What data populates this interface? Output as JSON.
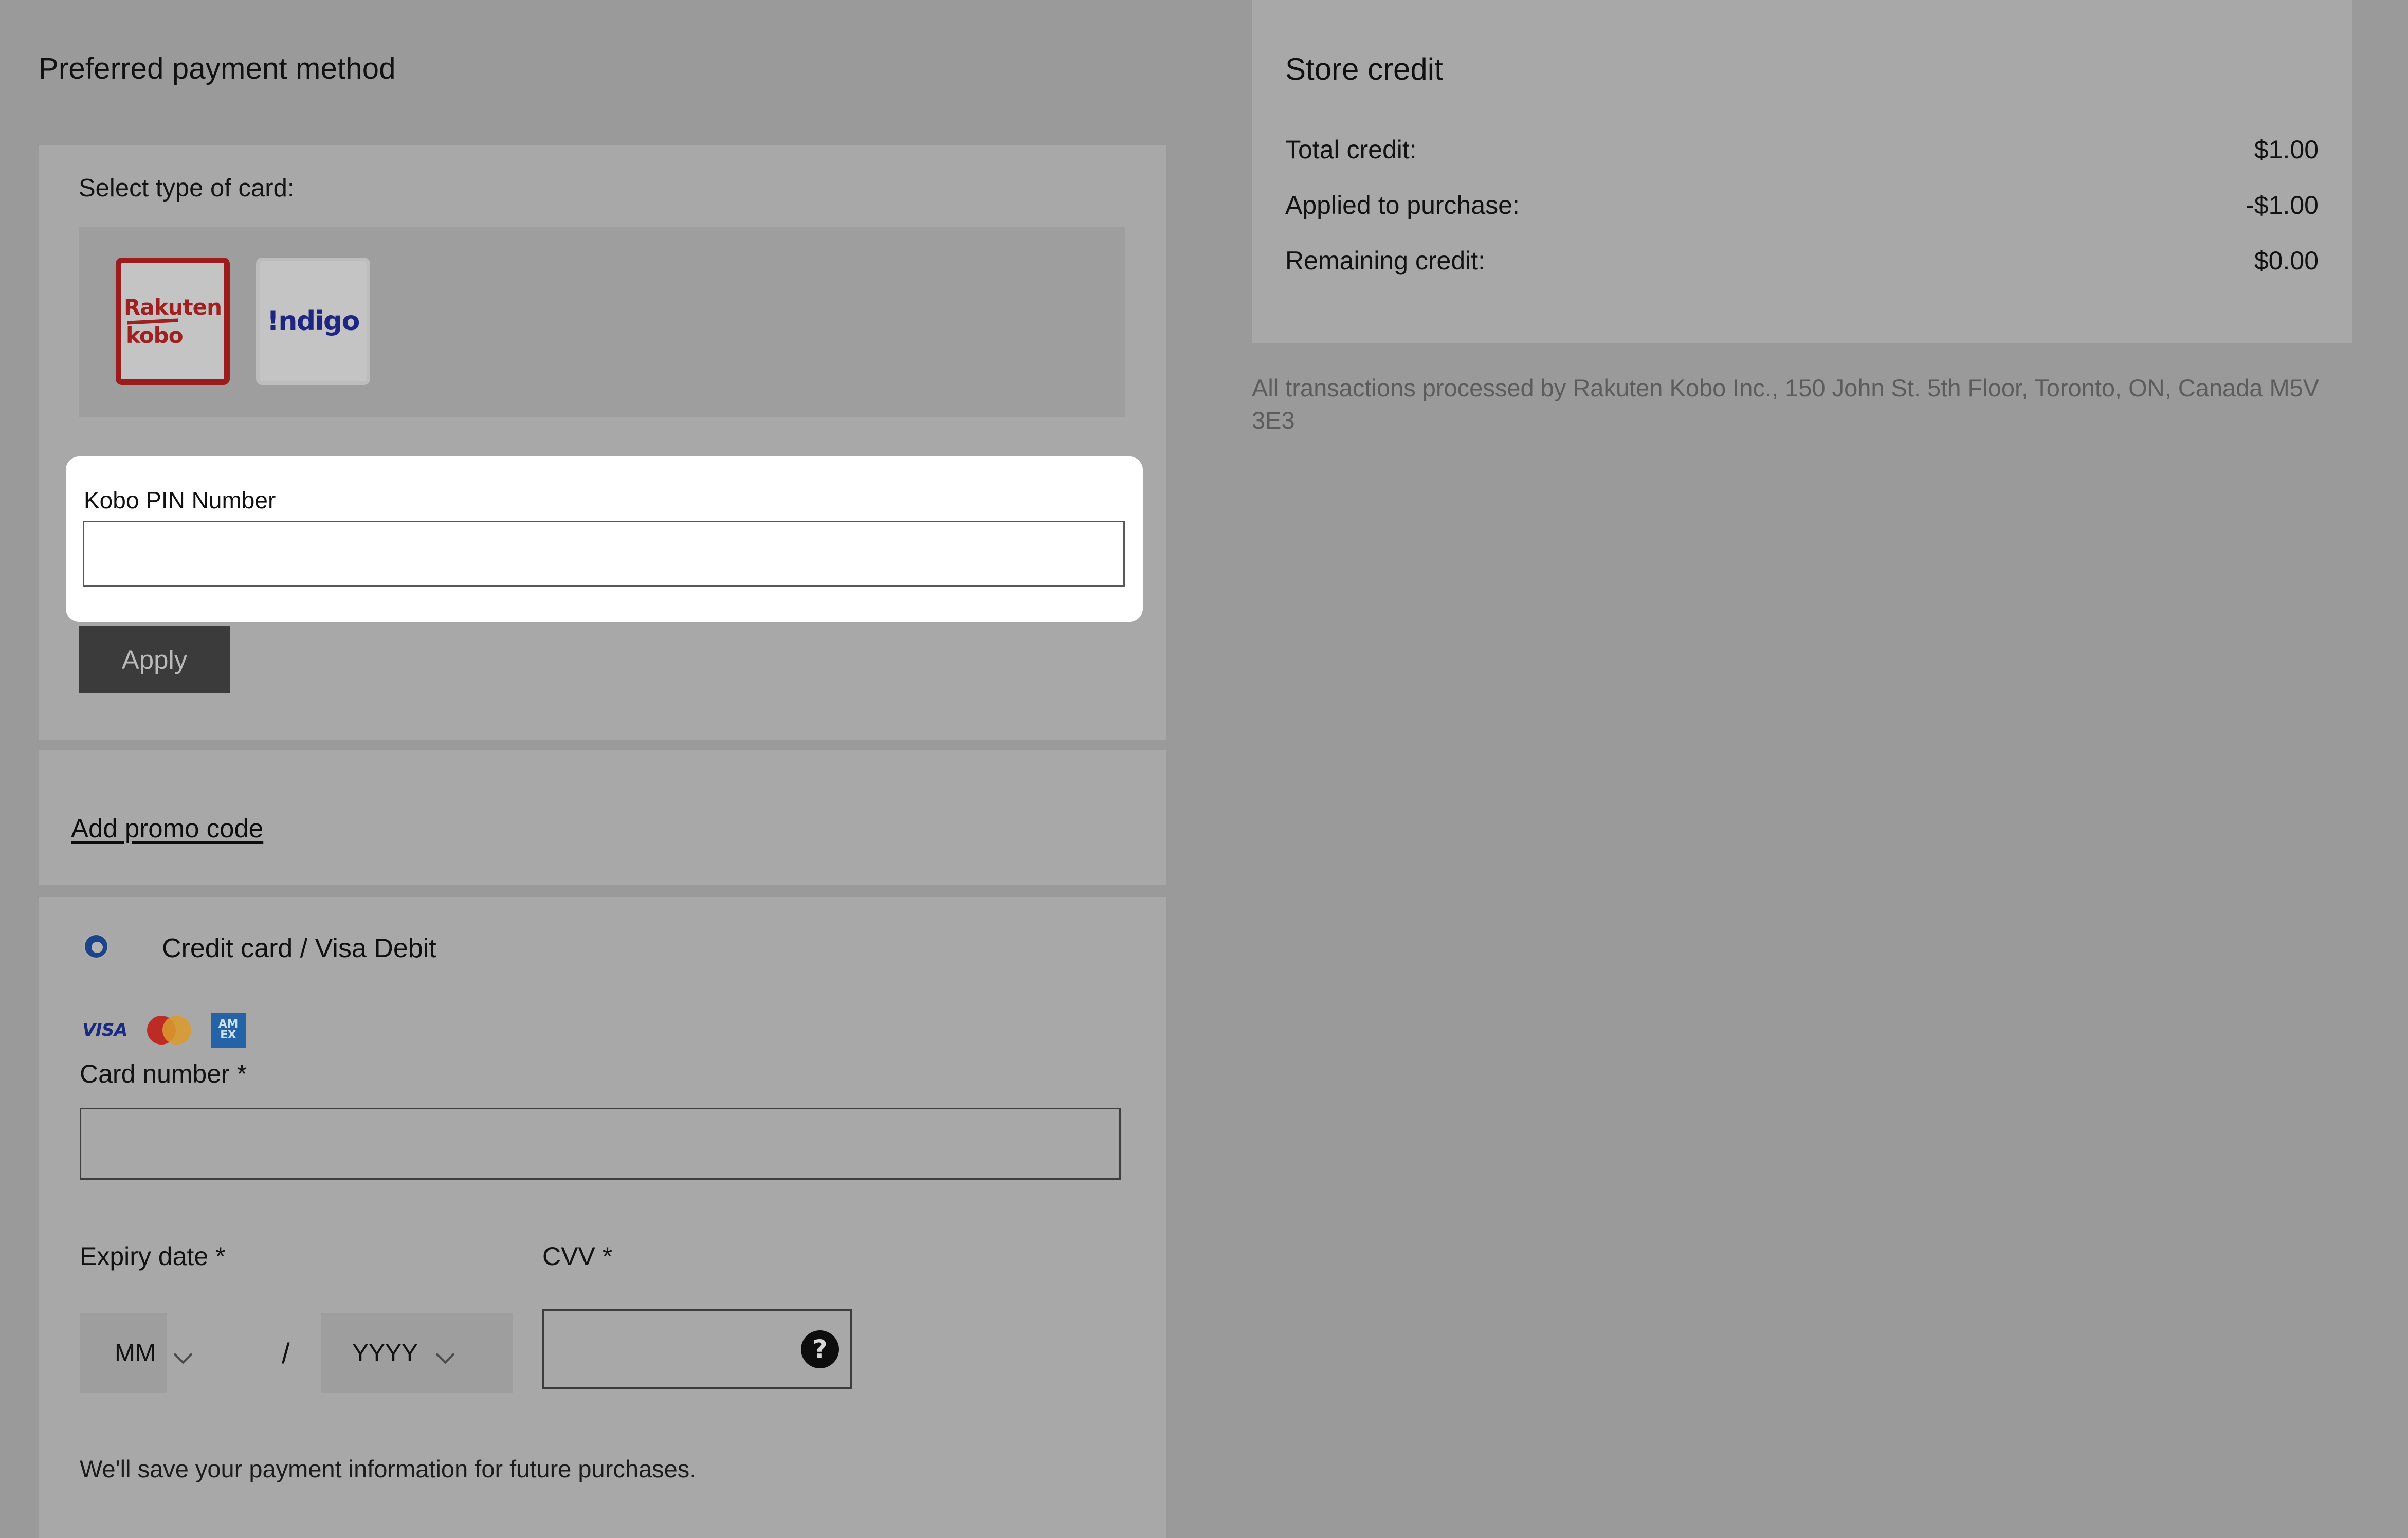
{
  "page": {
    "title": "Preferred payment method"
  },
  "card_type_section": {
    "label": "Select type of card:",
    "options": [
      {
        "name": "rakuten-kobo",
        "wordmark_top": "Rakuten",
        "wordmark_bottom": "kobo",
        "selected": true
      },
      {
        "name": "indigo",
        "wordmark": "!ndigo",
        "selected": false
      }
    ]
  },
  "kobo_pin": {
    "label": "Kobo PIN Number",
    "value": "",
    "placeholder": ""
  },
  "apply_button": {
    "label": "Apply"
  },
  "promo": {
    "link_label": "Add promo code"
  },
  "credit_card_section": {
    "radio_label": "Credit card / Visa Debit",
    "brands": [
      {
        "name": "visa-icon",
        "label": "VISA"
      },
      {
        "name": "mastercard-icon",
        "label": ""
      },
      {
        "name": "amex-icon",
        "label_top": "AM",
        "label_bottom": "EX"
      }
    ],
    "card_number_label": "Card number *",
    "card_number_value": "",
    "expiry_label": "Expiry date *",
    "expiry_month_value": "MM",
    "expiry_year_value": "YYYY",
    "expiry_separator": "/",
    "cvv_label": "CVV *",
    "cvv_value": "",
    "cvv_help_glyph": "?",
    "save_note": "We'll save your payment information for future purchases."
  },
  "store_credit": {
    "title": "Store credit",
    "rows": [
      {
        "label": "Total credit:",
        "value": "$1.00"
      },
      {
        "label": "Applied to purchase:",
        "value": "-$1.00"
      },
      {
        "label": "Remaining credit:",
        "value": "$0.00"
      }
    ]
  },
  "processor_note": "All transactions processed by Rakuten Kobo Inc., 150 John St. 5th Floor, Toronto, ON, Canada M5V 3E3",
  "colors": {
    "page_overlay": "#9a9a9a",
    "panel": "#a8a8a8",
    "kobo_red": "#9e2020",
    "indigo_blue": "#1f2582",
    "radio_blue": "#1d4489",
    "apply_button_bg": "#3b3b3b",
    "focus_card_bg": "#ffffff"
  }
}
